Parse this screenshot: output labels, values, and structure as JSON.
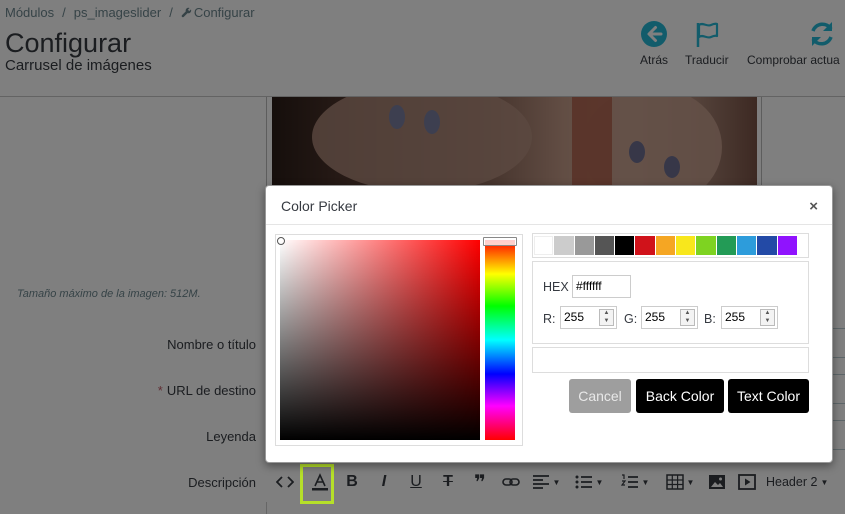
{
  "breadcrumb": {
    "items": [
      "Módulos",
      "ps_imageslider",
      "Configurar"
    ],
    "separator": "/"
  },
  "header": {
    "title": "Configurar",
    "subtitle": "Carrusel de imágenes"
  },
  "toolbar": {
    "back_label": "Atrás",
    "translate_label": "Traducir",
    "check_updates_label": "Comprobar actua"
  },
  "form": {
    "max_size_note": "Tamaño máximo de la imagen: 512M.",
    "title_label": "Nombre o título",
    "url_label": "URL de destino",
    "required_mark": "*",
    "caption_label": "Leyenda",
    "description_label": "Descripción"
  },
  "editor": {
    "heading_select": "Header 2",
    "icons": [
      "code-view-icon",
      "text-color-icon",
      "bold-icon",
      "italic-icon",
      "underline-icon",
      "strikethrough-icon",
      "quote-icon",
      "link-icon",
      "align-icon",
      "bullet-list-icon",
      "numbered-list-icon",
      "table-icon",
      "image-icon",
      "video-icon"
    ]
  },
  "color_picker": {
    "title": "Color Picker",
    "close": "×",
    "palette": [
      "#ffffff",
      "#cccccc",
      "#999999",
      "#555555",
      "#000000",
      "#d0121a",
      "#f5a623",
      "#f8e71c",
      "#7ed321",
      "#239b56",
      "#2d9cdb",
      "#234aa6",
      "#9013fe"
    ],
    "hex_label": "HEX",
    "hex_value": "#ffffff",
    "r_label": "R:",
    "g_label": "G:",
    "b_label": "B:",
    "r_value": "255",
    "g_value": "255",
    "b_value": "255",
    "cancel_label": "Cancel",
    "back_color_label": "Back Color",
    "text_color_label": "Text Color"
  },
  "colors": {
    "highlight": "#b6e029",
    "required": "#c05c67",
    "accent": "#25b9d7"
  }
}
